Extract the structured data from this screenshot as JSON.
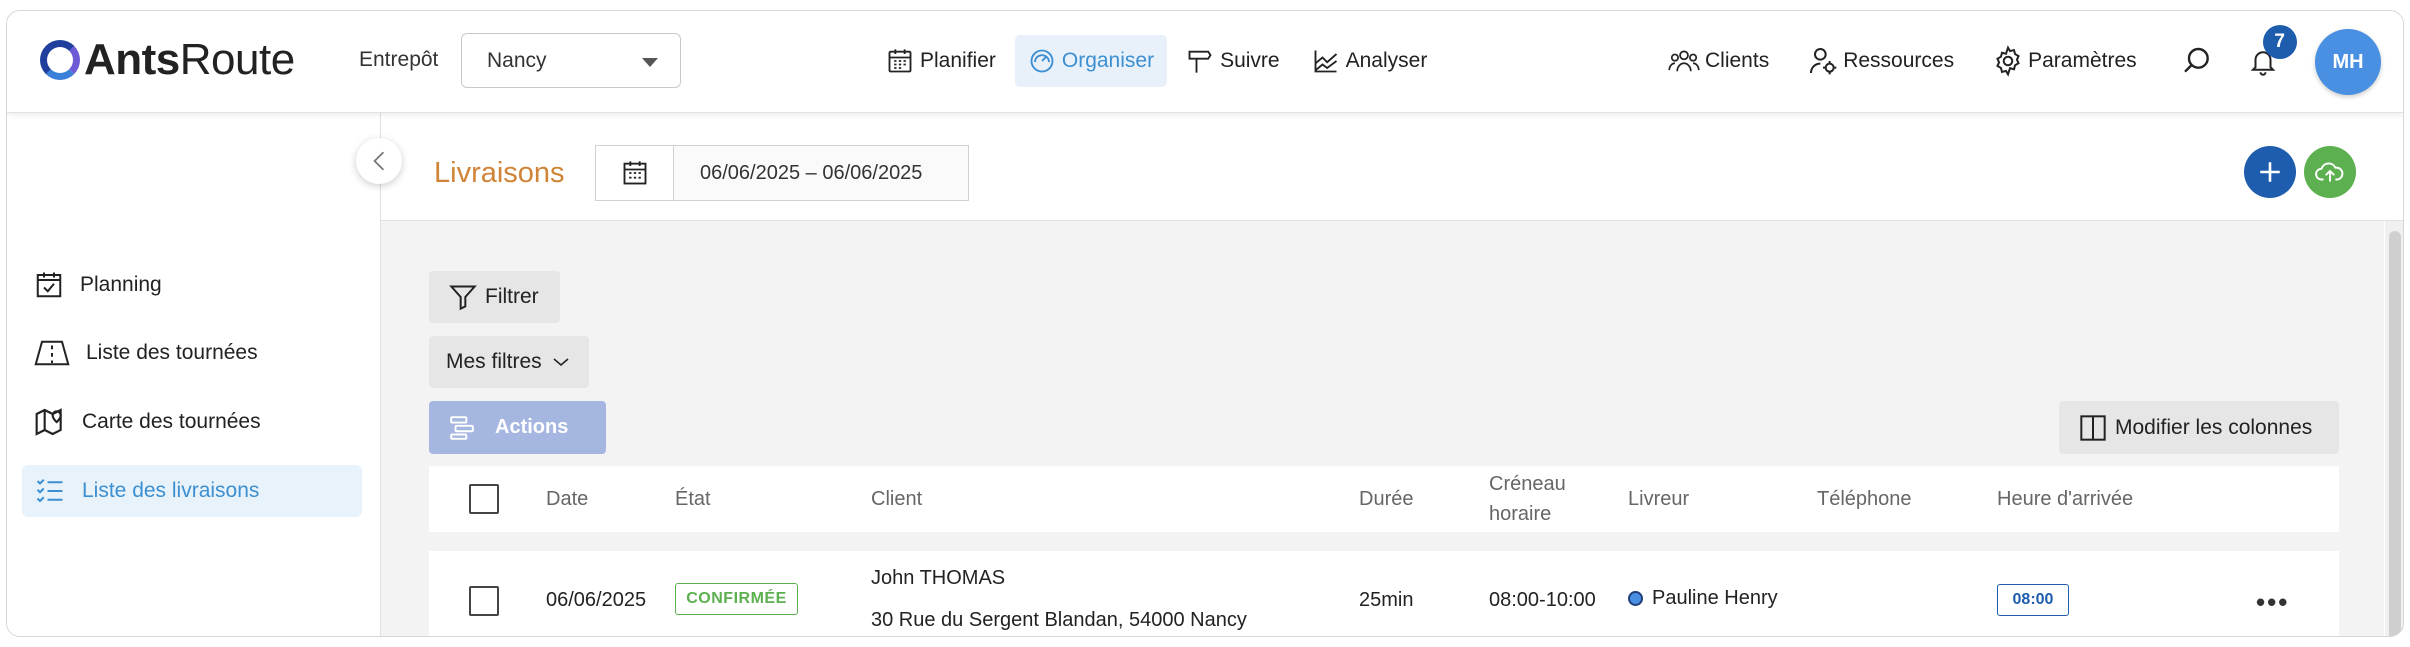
{
  "app": {
    "logo_bold": "Ants",
    "logo_light": "Route"
  },
  "topnav": {
    "warehouse_label": "Entrepôt",
    "warehouse_value": "Nancy",
    "menu": [
      {
        "label": "Planifier",
        "icon": "calendar-grid-icon"
      },
      {
        "label": "Organiser",
        "icon": "gauge-icon",
        "active": true
      },
      {
        "label": "Suivre",
        "icon": "signpost-icon"
      },
      {
        "label": "Analyser",
        "icon": "chart-line-icon"
      }
    ],
    "right": [
      {
        "label": "Clients",
        "icon": "users-group-icon"
      },
      {
        "label": "Ressources",
        "icon": "user-gear-icon"
      },
      {
        "label": "Paramètres",
        "icon": "gear-icon"
      }
    ],
    "notifications_count": "7",
    "avatar_initials": "MH"
  },
  "sidebar": {
    "items": [
      {
        "label": "Planning",
        "icon": "calendar-check-icon"
      },
      {
        "label": "Liste des tournées",
        "icon": "road-icon"
      },
      {
        "label": "Carte des tournées",
        "icon": "map-pin-icon"
      },
      {
        "label": "Liste des livraisons",
        "icon": "checklist-icon",
        "active": true
      }
    ]
  },
  "header": {
    "title": "Livraisons",
    "date_range": "06/06/2025 – 06/06/2025"
  },
  "toolbar": {
    "filter_label": "Filtrer",
    "my_filters_label": "Mes filtres",
    "actions_label": "Actions",
    "columns_label": "Modifier les colonnes"
  },
  "table": {
    "columns": [
      "Date",
      "État",
      "Client",
      "Durée",
      "Créneau horaire",
      "Livreur",
      "Téléphone",
      "Heure d'arrivée"
    ],
    "column_creneau_line1": "Créneau",
    "column_creneau_line2": "horaire",
    "rows": [
      {
        "date": "06/06/2025",
        "status": "CONFIRMÉE",
        "client_name": "John THOMAS",
        "client_address": "30 Rue du Sergent Blandan, 54000 Nancy",
        "duration": "25min",
        "slot": "08:00-10:00",
        "driver": "Pauline Henry",
        "phone": "",
        "arrival": "08:00"
      }
    ]
  },
  "colors": {
    "accent_blue": "#1e5cae",
    "active_blue": "#3c8fd0",
    "title_orange": "#d08437",
    "success_green": "#5cb04f",
    "actions_disabled": "#a5b6e0"
  }
}
